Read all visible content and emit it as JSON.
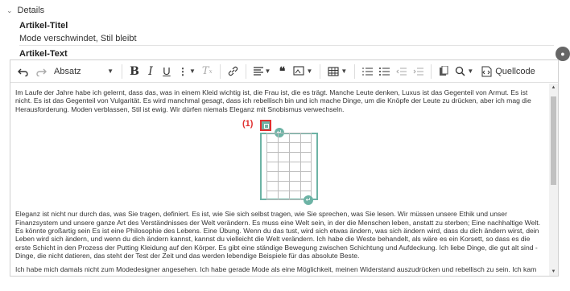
{
  "section": {
    "title": "Details"
  },
  "fields": {
    "title_label": "Artikel-Titel",
    "title_value": "Mode verschwindet, Stil bleibt",
    "text_label": "Artikel-Text"
  },
  "toolbar": {
    "paragraph_format": "Absatz",
    "source_label": "Quellcode"
  },
  "annotation": {
    "marker": "(1)"
  },
  "content": {
    "paragraph_1": "Im Laufe der Jahre habe ich gelernt, dass das, was in einem Kleid wichtig ist, die Frau ist, die es trägt. Manche Leute denken, Luxus ist das Gegenteil von Armut. Es ist nicht. Es ist das Gegenteil von Vulgarität. Es wird manchmal gesagt, dass ich rebellisch bin und ich mache Dinge, um die Knöpfe der Leute zu drücken, aber ich mag die Herausforderung. Moden verblassen, Stil ist ewig. Wir dürfen niemals Eleganz mit Snobismus verwechseln.",
    "paragraph_2": "Eleganz ist nicht nur durch das, was Sie tragen, definiert. Es ist, wie Sie sich selbst tragen, wie Sie sprechen, was Sie lesen. Wir müssen unsere Ethik und unser Finanzsystem und unsere ganze Art des Verständnisses der Welt verändern. Es muss eine Welt sein, in der die Menschen leben, anstatt zu sterben; Eine nachhaltige Welt. Es könnte großartig sein Es ist eine Philosophie des Lebens. Eine Übung. Wenn du das tust, wird sich etwas ändern, was sich ändern wird, dass du dich ändern wirst, dein Leben wird sich ändern, und wenn du dich ändern kannst, kannst du vielleicht die Welt verändern. Ich habe die Weste behandelt, als wäre es ein Korsett, so dass es die erste Schicht in den Prozess der Putting Kleidung auf den Körper. Es gibt eine ständige Bewegung zwischen Schichtung und Aufdeckung. Ich liebe Dinge, die gut alt sind - Dinge, die nicht datieren, das steht der Test der Zeit und das werden lebendige Beispiele für das absolute Beste.",
    "paragraph_3": "Ich habe mich damals nicht zum Modedesigner angesehen. Ich habe gerade Mode als eine Möglichkeit, meinen Widerstand auszudrücken und rebellisch zu sein. Ich kam"
  },
  "colors": {
    "table_accent": "#6db3a5",
    "annotation_red": "#e03030"
  }
}
